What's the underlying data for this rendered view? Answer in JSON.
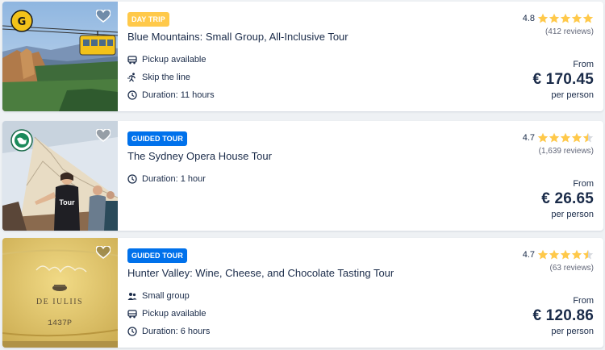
{
  "colors": {
    "accent_blue": "#0071eb",
    "day_trip_yellow": "#ffc94a",
    "star_yellow": "#ffc94a",
    "text_dark": "#1a2b49",
    "text_muted": "#63687a"
  },
  "tours": [
    {
      "tag": "Day trip",
      "tag_style": "day",
      "title": "Blue Mountains: Small Group, All-Inclusive Tour",
      "rating": "4.8",
      "stars": 5,
      "reviews": "(412 reviews)",
      "from_label": "From",
      "price": "€ 170.45",
      "per_label": "per person",
      "features": [
        {
          "icon": "bus-icon",
          "text": "Pickup available"
        },
        {
          "icon": "skip-line-icon",
          "text": "Skip the line"
        },
        {
          "icon": "clock-icon",
          "text": "Duration: 11 hours"
        }
      ]
    },
    {
      "tag": "Guided tour",
      "tag_style": "guided",
      "title": "The Sydney Opera House Tour",
      "rating": "4.7",
      "stars": 4.5,
      "reviews": "(1,639 reviews)",
      "from_label": "From",
      "price": "€ 26.65",
      "per_label": "per person",
      "image_text": "Tour",
      "features": [
        {
          "icon": "clock-icon",
          "text": "Duration: 1 hour"
        }
      ]
    },
    {
      "tag": "Guided tour",
      "tag_style": "guided",
      "title": "Hunter Valley: Wine, Cheese, and Chocolate Tasting Tour",
      "rating": "4.7",
      "stars": 4.5,
      "reviews": "(63 reviews)",
      "from_label": "From",
      "price": "€ 120.86",
      "per_label": "per person",
      "image_text_lines": [
        "DE IULIIS",
        "1437P"
      ],
      "features": [
        {
          "icon": "group-icon",
          "text": "Small group"
        },
        {
          "icon": "bus-icon",
          "text": "Pickup available"
        },
        {
          "icon": "clock-icon",
          "text": "Duration: 6 hours"
        }
      ]
    }
  ]
}
